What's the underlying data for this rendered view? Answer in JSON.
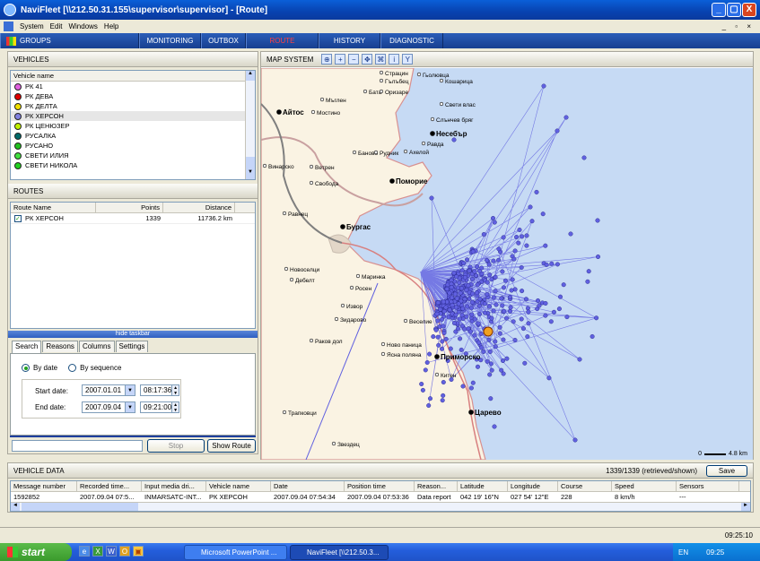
{
  "window": {
    "title": "NaviFleet [\\\\212.50.31.155\\supervisor\\supervisor] - [Route]",
    "controls": {
      "minimize": "_",
      "maximize": "▢",
      "close": "X"
    }
  },
  "menu": {
    "items": [
      "System",
      "Edit",
      "Windows",
      "Help"
    ],
    "mdi_controls": "_ ▫ ×"
  },
  "nav": {
    "groups": "GROUPS",
    "tabs": [
      "MONITORING",
      "OUTBOX",
      "ROUTE",
      "HISTORY",
      "DIAGNOSTIC"
    ],
    "active": "ROUTE",
    "active_color": "#FF4040"
  },
  "vehicles": {
    "header": "VEHICLES",
    "column": "Vehicle name",
    "items": [
      {
        "name": "РК 41",
        "color": "#E060E0"
      },
      {
        "name": "РК ДЕВА",
        "color": "#E00000"
      },
      {
        "name": "РК ДЕЛТА",
        "color": "#F0E000"
      },
      {
        "name": "РК ХЕРСОН",
        "color": "#8080E0"
      },
      {
        "name": "РК ЦЕНЮЗЕР",
        "color": "#C0F000"
      },
      {
        "name": "РУСАЛКА",
        "color": "#006A6A"
      },
      {
        "name": "РУСАНО",
        "color": "#20C020"
      },
      {
        "name": "СВЕТИ ИЛИЯ",
        "color": "#40E040"
      },
      {
        "name": "СВЕТИ НИКОЛА",
        "color": "#20D020"
      }
    ],
    "selected_index": 3
  },
  "routes": {
    "header": "ROUTES",
    "columns": [
      "Route Name",
      "Points",
      "Distance"
    ],
    "rows": [
      {
        "name": "РК ХЕРСОН",
        "points": "1339",
        "distance": "11736.2 km",
        "checked": true
      }
    ]
  },
  "taskbar_toggle": "hide taskbar",
  "search": {
    "tabs": [
      "Search",
      "Reasons",
      "Columns",
      "Settings"
    ],
    "active_tab": "Search",
    "mode_by_date": "By date",
    "mode_by_sequence": "By sequence",
    "start_label": "Start date:",
    "start_date": "2007.01.01",
    "start_time": "08:17:36",
    "end_label": "End date:",
    "end_date": "2007.09.04",
    "end_time": "09:21:00",
    "stop_button": "Stop",
    "show_route_button": "Show Route"
  },
  "map": {
    "header": "MAP SYSTEM",
    "tools": [
      "zoom-fit",
      "zoom-in",
      "zoom-out",
      "pan",
      "extent",
      "info",
      "filter"
    ],
    "scale_label": "4.8 km",
    "route_color": "#6060E0",
    "towns": [
      "Айтос",
      "Мостино",
      "Мъглен",
      "Страцин",
      "Гълъбец",
      "Гьолювца",
      "Кошарица",
      "Бата",
      "Оризаре",
      "Свети влас",
      "Слънчев бряг",
      "Несебър",
      "Равда",
      "Ахелой",
      "Баново",
      "Рудник",
      "Винарско",
      "Ветрен",
      "Свобода",
      "Поморие",
      "Равнец",
      "Бургас",
      "Новоселци",
      "Дебелт",
      "Маринка",
      "Росен",
      "Извор",
      "Зидарово",
      "Веселие",
      "Раков дол",
      "Ново паница",
      "Ясна поляна",
      "Приморско",
      "Китен",
      "Трапковци",
      "Царево",
      "Звездец"
    ]
  },
  "vehicle_data": {
    "header": "VEHICLE DATA",
    "counter": "1339/1339 (retrieved/shown)",
    "save_button": "Save",
    "columns": [
      "Message number",
      "Recorded time...",
      "Input media dri...",
      "Vehicle name",
      "Date",
      "Position time",
      "Reason...",
      "Latitude",
      "Longitude",
      "Course",
      "Speed",
      "Sensors"
    ],
    "rows": [
      [
        "1592852",
        "2007.09.04 07:5...",
        "INMARSATC-INT...",
        "РК ХЕРСОН",
        "2007.09.04 07:54:34",
        "2007.09.04 07:53:36",
        "Data report",
        "042 19' 16\"N",
        "027 54' 12\"E",
        "228",
        "8 km/h",
        "---"
      ]
    ]
  },
  "status": {
    "time": "09:25:10"
  },
  "os_taskbar": {
    "start": "start",
    "tasks": [
      "Microsoft PowerPoint ...",
      "NaviFleet [\\\\212.50.3..."
    ],
    "lang": "EN",
    "clock": "09:25"
  }
}
